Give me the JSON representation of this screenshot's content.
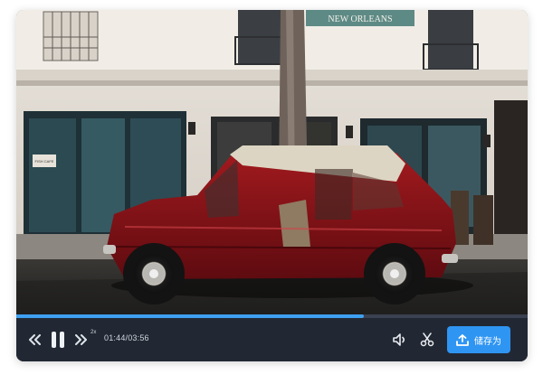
{
  "player": {
    "time_display": "01:44/03:56",
    "speed_label": "2x",
    "progress": 0.68,
    "save_label": "储存为",
    "storefront_sign": "NEW ORLEANS",
    "shop_sign": "FISH CAFE"
  },
  "icons": {
    "rewind": "rewind-icon",
    "pause": "pause-icon",
    "fast_forward": "fast-forward-icon",
    "volume": "volume-icon",
    "cut": "scissors-icon",
    "upload": "upload-icon"
  },
  "colors": {
    "accent": "#2f95f3",
    "progress": "#3ea0f0",
    "control_bar": "#222833"
  }
}
